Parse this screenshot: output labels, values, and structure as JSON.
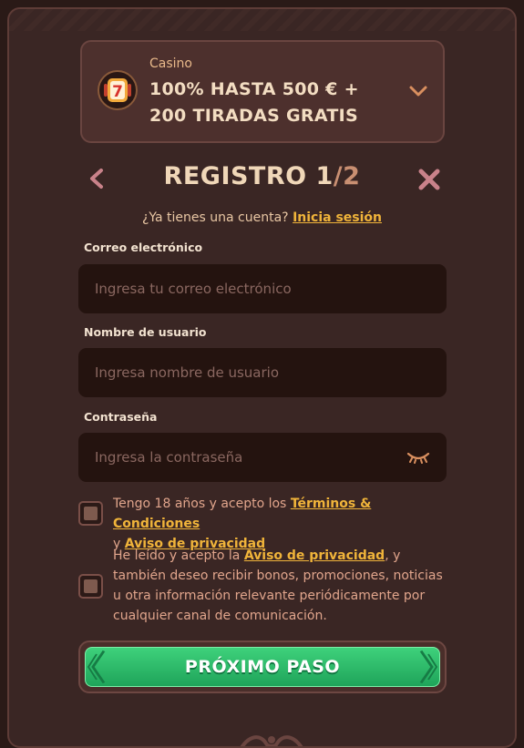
{
  "promo": {
    "category": "Casino",
    "title": "100% HASTA 500 € + 200 TIRADAS GRATIS",
    "icon": "slot-seven-icon",
    "expand_icon": "chevron-down-icon"
  },
  "header": {
    "title_main": "REGISTRO 1",
    "title_total": "/2",
    "back_icon": "chevron-left-icon",
    "close_icon": "close-icon"
  },
  "login": {
    "prompt": "¿Ya tienes una cuenta?",
    "link": "Inicia sesión"
  },
  "form": {
    "email": {
      "label": "Correo electrónico",
      "placeholder": "Ingresa tu correo electrónico",
      "value": ""
    },
    "username": {
      "label": "Nombre de usuario",
      "placeholder": "Ingresa nombre de usuario",
      "value": ""
    },
    "password": {
      "label": "Contraseña",
      "placeholder": "Ingresa la contraseña",
      "value": "",
      "toggle_icon": "eye-closed-icon"
    }
  },
  "consents": {
    "terms": {
      "text1": "Tengo 18 años y acepto los",
      "link1": "Términos & Condiciones",
      "text2": "y",
      "link2": "Aviso de privacidad",
      "checked": false
    },
    "marketing": {
      "text1": "He leído y acepto la",
      "link1": "Aviso de privacidad",
      "text2": ", y también deseo recibir bonos, promociones, noticias u otra información relevante periódicamente por cualquier canal de comunicación.",
      "checked": false
    }
  },
  "cta": {
    "label": "PRÓXIMO PASO"
  },
  "colors": {
    "background": "#3a2624",
    "accent": "#f0b43a",
    "cta_green": "#2ebf6a"
  }
}
